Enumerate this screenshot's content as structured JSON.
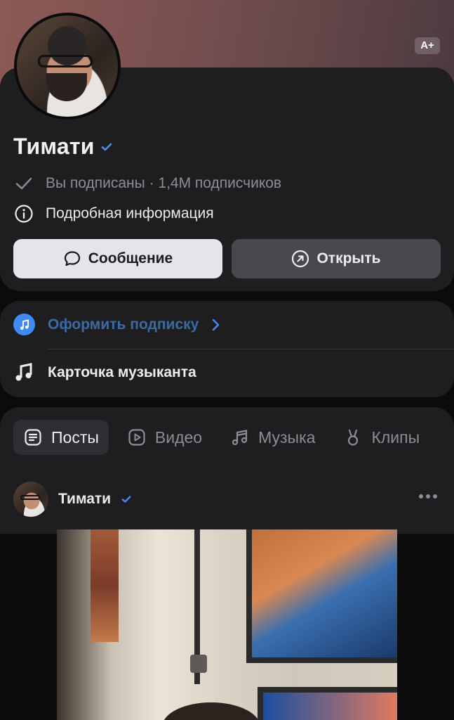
{
  "header": {
    "font_size_badge": "A+"
  },
  "profile": {
    "name": "Тимати",
    "subscribed_status": "Вы подписаны · 1,4M подписчиков",
    "details_label": "Подробная информация",
    "message_button": "Сообщение",
    "open_button": "Открыть"
  },
  "music": {
    "subscribe_link": "Оформить подписку",
    "musician_card": "Карточка музыканта"
  },
  "tabs": [
    {
      "label": "Посты",
      "icon": "posts-icon",
      "active": true
    },
    {
      "label": "Видео",
      "icon": "video-icon",
      "active": false
    },
    {
      "label": "Музыка",
      "icon": "music-icon",
      "active": false
    },
    {
      "label": "Клипы",
      "icon": "clips-icon",
      "active": false
    }
  ],
  "post": {
    "author": "Тимати"
  },
  "colors": {
    "accent_blue": "#3f8af7",
    "link_blue": "#3b6aa5",
    "card_bg": "#1e1e20",
    "verified": "#4a8ff0"
  }
}
